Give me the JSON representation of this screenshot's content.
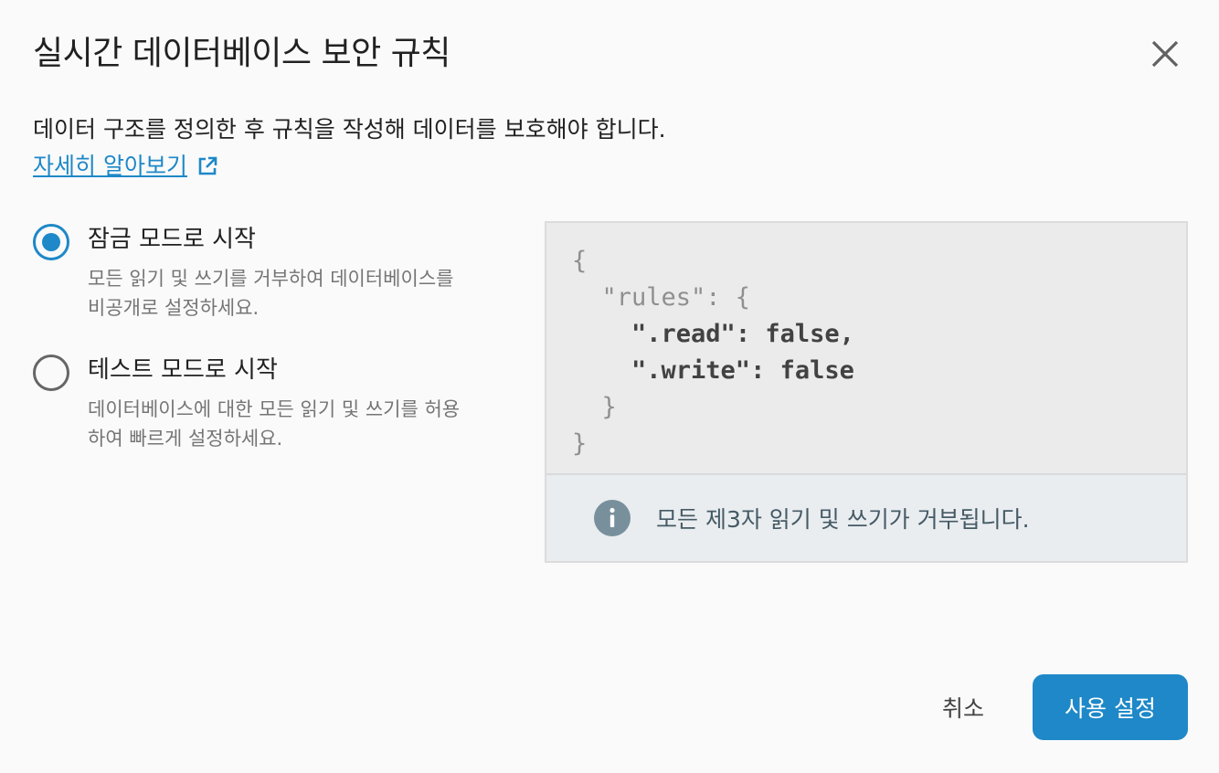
{
  "dialog": {
    "title": "실시간 데이터베이스 보안 규칙",
    "close_icon": "close-icon",
    "description": "데이터 구조를 정의한 후 규칙을 작성해 데이터를 보호해야 합니다.",
    "learn_more": "자세히 알아보기",
    "learn_more_icon": "external-link-icon"
  },
  "options": [
    {
      "label": "잠금 모드로 시작",
      "help": "모든 읽기 및 쓰기를 거부하여 데이터베이스를 비공개로 설정하세요.",
      "selected": true
    },
    {
      "label": "테스트 모드로 시작",
      "help": "데이터베이스에 대한 모든 읽기 및 쓰기를 허용하여 빠르게 설정하세요.",
      "selected": false
    }
  ],
  "rules_code": {
    "line1": "{",
    "line2": "  \"rules\": {",
    "line3_key": "    \".read\"",
    "line3_sep": ": ",
    "line3_val": "false,",
    "line4_key": "    \".write\"",
    "line4_sep": ": ",
    "line4_val": "false",
    "line5": "  }",
    "line6": "}"
  },
  "info": {
    "icon": "info-icon",
    "text": "모든 제3자 읽기 및 쓰기가 거부됩니다."
  },
  "actions": {
    "cancel": "취소",
    "confirm": "사용 설정"
  },
  "colors": {
    "accent": "#1e88c8",
    "info_bg": "#e9edf0",
    "code_bg": "#ebebeb"
  }
}
